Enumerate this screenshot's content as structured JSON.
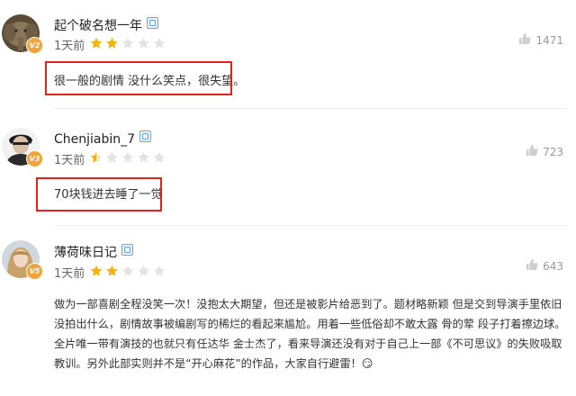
{
  "comments": [
    {
      "username": "起个破名想一年",
      "level": "V2",
      "time": "1天前",
      "rating": 2,
      "likes": "1471",
      "text": "很一般的剧情 没什么笑点，很失望。",
      "highlighted": true
    },
    {
      "username": "Chenjiabin_7",
      "level": "V3",
      "time": "1天前",
      "rating": 0.5,
      "likes": "723",
      "text": "70块钱进去睡了一觉",
      "highlighted": true
    },
    {
      "username": "薄荷味日记",
      "level": "V5",
      "time": "1天前",
      "rating": 2,
      "likes": "643",
      "text_lines": [
        "做为一部喜剧全程没笑一次！没抱太大期望，但还是被影片给恶到了。题材略新颖 但是交到导演手里依旧",
        "没拍出什么，剧情故事被编剧写的稀烂的看起来尴尬。用着一些低俗却不敢太露 骨的荤 段子打着擦边球。",
        "全片唯一带有演技的也就只有任达华 金士杰了，看来导演还没有对于自己上一部《不可思议》的失败吸取",
        "教训。另外此部实则并不是“开心麻花”的作品，大家自行避雷！😏"
      ],
      "highlighted": false
    }
  ],
  "colors": {
    "star_filled": "#f5b400",
    "star_empty": "#e3e3e3",
    "highlight_border": "#e2231a",
    "level_badge": "#f2a33a"
  },
  "icons": {
    "like": "thumbs-up-icon",
    "verified": "vip-badge-icon",
    "star": "star-icon"
  }
}
